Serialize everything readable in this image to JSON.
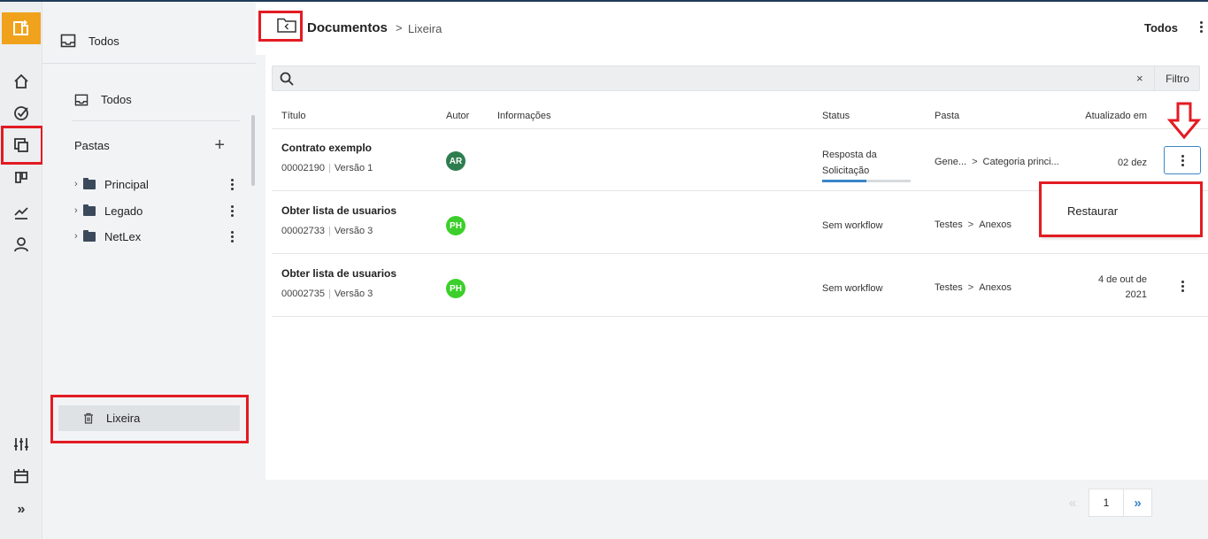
{
  "app": {
    "logo_glyph": "⊕",
    "accent": "#f0a21c",
    "highlight": "#e31b23"
  },
  "rail": {
    "items": [
      "home-icon",
      "check-circle-icon",
      "documents-icon",
      "board-icon",
      "chart-icon",
      "user-icon"
    ],
    "bottom": [
      "settings-sliders-icon",
      "calendar-icon",
      "expand-icon"
    ],
    "expand_glyph": "»"
  },
  "panel": {
    "head_label": "Todos",
    "todos_label": "Todos",
    "folders_heading": "Pastas",
    "add_glyph": "+",
    "folders": [
      {
        "name": "Principal"
      },
      {
        "name": "Legado"
      },
      {
        "name": "NetLex"
      }
    ],
    "trash_label": "Lixeira"
  },
  "header": {
    "title": "Documentos",
    "separator": ">",
    "sub": "Lixeira",
    "view_label": "Todos"
  },
  "search": {
    "placeholder": "",
    "clear_glyph": "×",
    "filter_label": "Filtro"
  },
  "table": {
    "columns": {
      "title": "Título",
      "author": "Autor",
      "info": "Informações",
      "status": "Status",
      "folder": "Pasta",
      "updated": "Atualizado em"
    },
    "rows": [
      {
        "title": "Contrato exemplo",
        "code": "00002190",
        "version": "Versão 1",
        "author_initials": "AR",
        "author_color": "#2e7d4f",
        "status": "Resposta da Solicitação",
        "status_line1": "Resposta da",
        "status_line2": "Solicitação",
        "progress": 0.5,
        "folder_a": "Gene...",
        "folder_b": "Categoria princi...",
        "updated": "02 dez"
      },
      {
        "title": "Obter lista de usuarios",
        "code": "00002733",
        "version": "Versão 3",
        "author_initials": "PH",
        "author_color": "#3ccf2b",
        "status": "Sem workflow",
        "folder_a": "Testes",
        "folder_b": "Anexos",
        "updated": ""
      },
      {
        "title": "Obter lista de usuarios",
        "code": "00002735",
        "version": "Versão 3",
        "author_initials": "PH",
        "author_color": "#3ccf2b",
        "status": "Sem workflow",
        "folder_a": "Testes",
        "folder_b": "Anexos",
        "updated_line1": "4 de out de",
        "updated_line2": "2021"
      }
    ]
  },
  "menu": {
    "restore_label": "Restaurar"
  },
  "pagination": {
    "prev_glyph": "«",
    "current": "1",
    "next_glyph": "»"
  }
}
